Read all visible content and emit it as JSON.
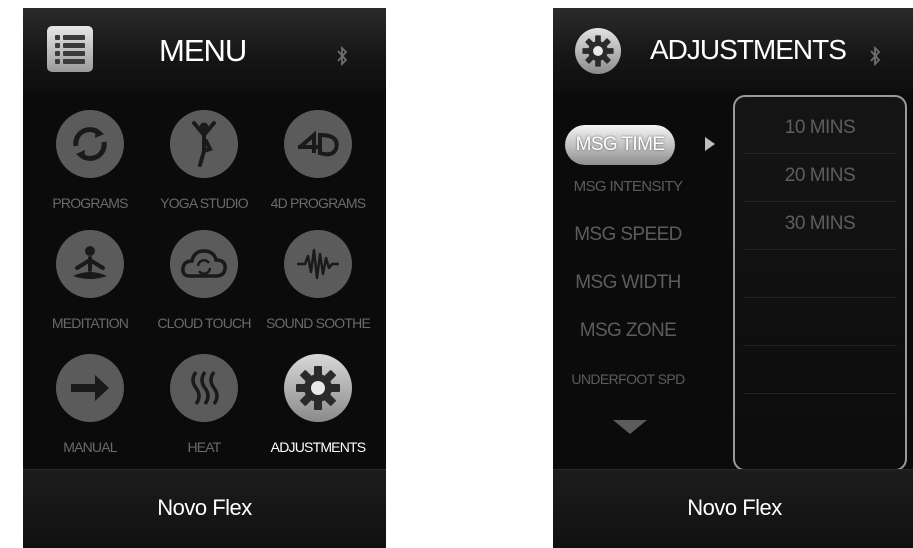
{
  "menu_screen": {
    "title": "MENU",
    "bluetooth_icon": "bluetooth-icon",
    "items": [
      {
        "label": "PROGRAMS",
        "icon": "programs-cycle-icon"
      },
      {
        "label": "YOGA STUDIO",
        "icon": "yoga-pose-icon"
      },
      {
        "label": "4D PROGRAMS",
        "icon": "4d-icon"
      },
      {
        "label": "MEDITATION",
        "icon": "meditation-icon"
      },
      {
        "label": "CLOUD TOUCH",
        "icon": "cloud-icon"
      },
      {
        "label": "SOUND SOOTHE",
        "icon": "sound-wave-icon"
      },
      {
        "label": "MANUAL",
        "icon": "arrow-right-icon"
      },
      {
        "label": "HEAT",
        "icon": "heat-icon"
      },
      {
        "label": "ADJUSTMENTS",
        "icon": "gear-icon"
      }
    ],
    "selected_item": "ADJUSTMENTS",
    "footer": "Novo Flex"
  },
  "adjustments_screen": {
    "title": "ADJUSTMENTS",
    "bluetooth_icon": "bluetooth-icon",
    "settings": [
      "MSG TIME",
      "MSG INTENSITY",
      "MSG SPEED",
      "MSG WIDTH",
      "MSG ZONE",
      "UNDERFOOT SPD"
    ],
    "selected_setting": "MSG TIME",
    "options": [
      "10 MINS",
      "20 MINS",
      "30 MINS"
    ],
    "footer": "Novo Flex"
  },
  "colors": {
    "panel_bg": "#0b0b0b",
    "inactive_icon": "#5b5b5b",
    "active_highlight": "#d8d8d8",
    "text_white": "#ffffff"
  }
}
